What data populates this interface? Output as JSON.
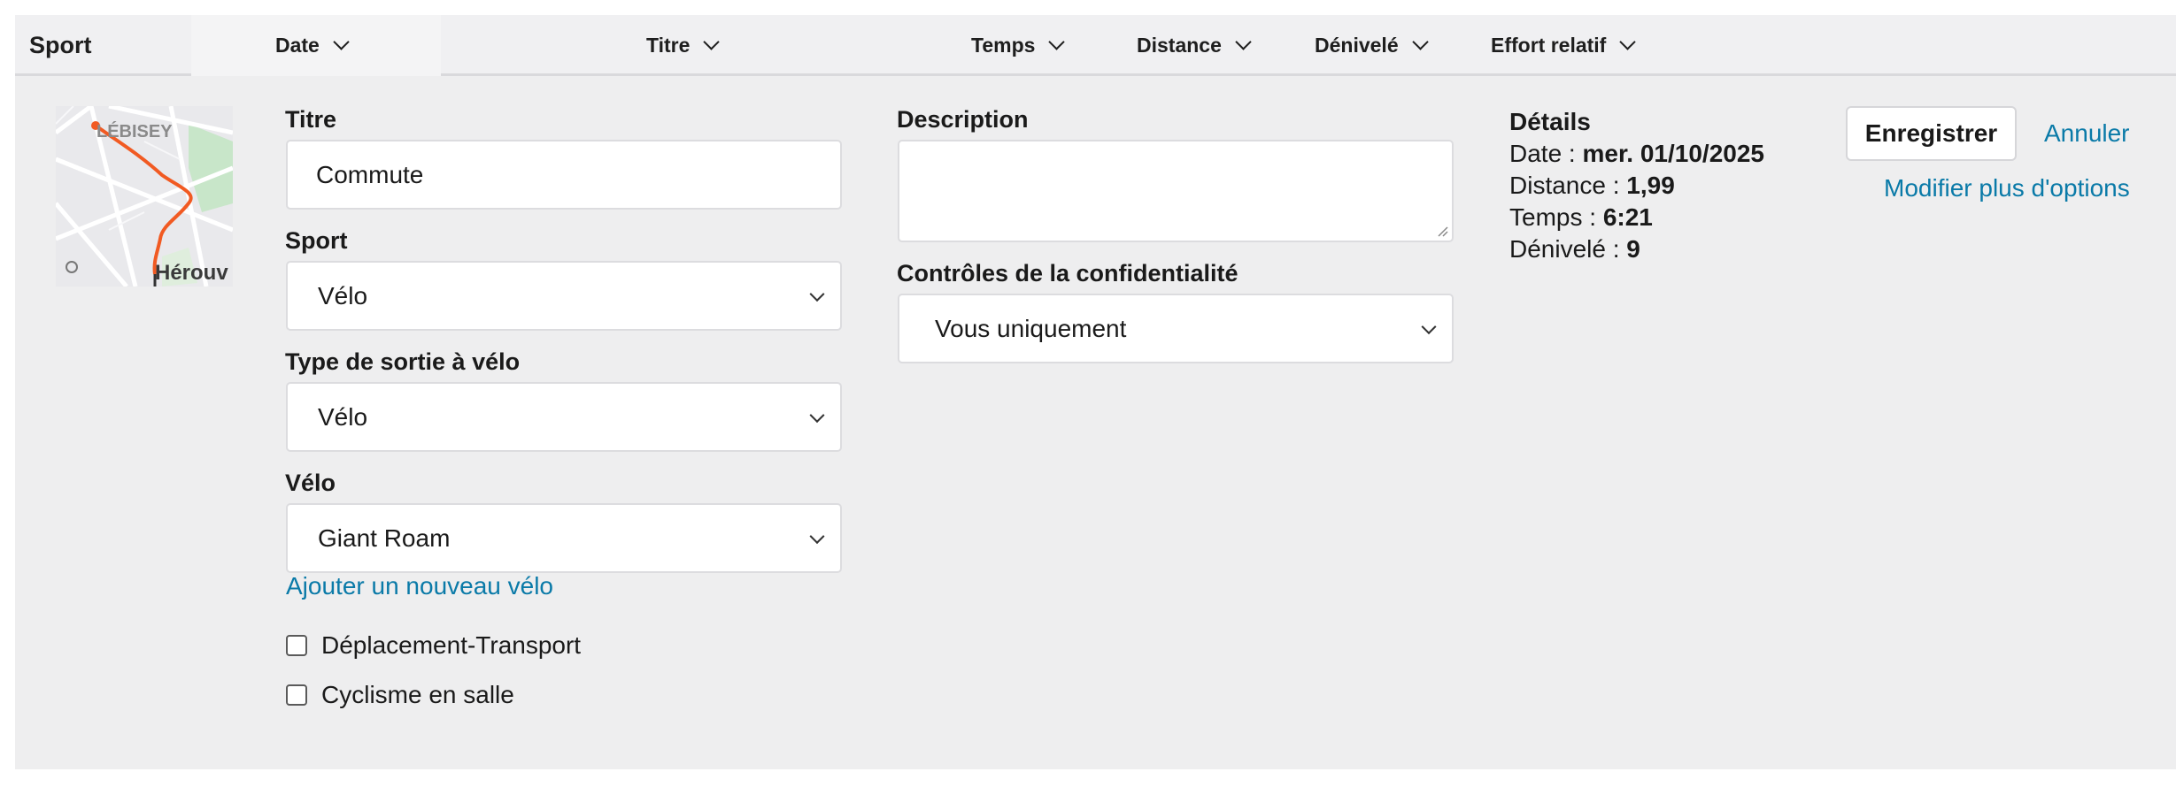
{
  "header": {
    "sport": "Sport",
    "date": "Date",
    "titre": "Titre",
    "temps": "Temps",
    "distance": "Distance",
    "denivele": "Dénivelé",
    "effort": "Effort relatif"
  },
  "map": {
    "label_top": "LÉBISEY",
    "label_bottom": "Hérouv",
    "route_color": "#f15a22"
  },
  "form": {
    "titre_label": "Titre",
    "titre_value": "Commute",
    "sport_label": "Sport",
    "sport_value": "Vélo",
    "type_label": "Type de sortie à vélo",
    "type_value": "Vélo",
    "velo_label": "Vélo",
    "velo_value": "Giant Roam",
    "add_bike_link": "Ajouter un nouveau vélo",
    "check1_label": "Déplacement-Transport",
    "check2_label": "Cyclisme en salle",
    "description_label": "Description",
    "description_value": "",
    "privacy_label": "Contrôles de la confidentialité",
    "privacy_value": "Vous uniquement"
  },
  "details": {
    "heading": "Détails",
    "date_label": "Date : ",
    "date_value": "mer. 01/10/2025",
    "distance_label": "Distance : ",
    "distance_value": "1,99",
    "temps_label": "Temps : ",
    "temps_value": "6:21",
    "denivele_label": "Dénivelé : ",
    "denivele_value": "9"
  },
  "actions": {
    "save": "Enregistrer",
    "cancel": "Annuler",
    "more_options": "Modifier plus d'options"
  },
  "colors": {
    "link": "#0a7aa8",
    "panel": "#eeeeef"
  }
}
